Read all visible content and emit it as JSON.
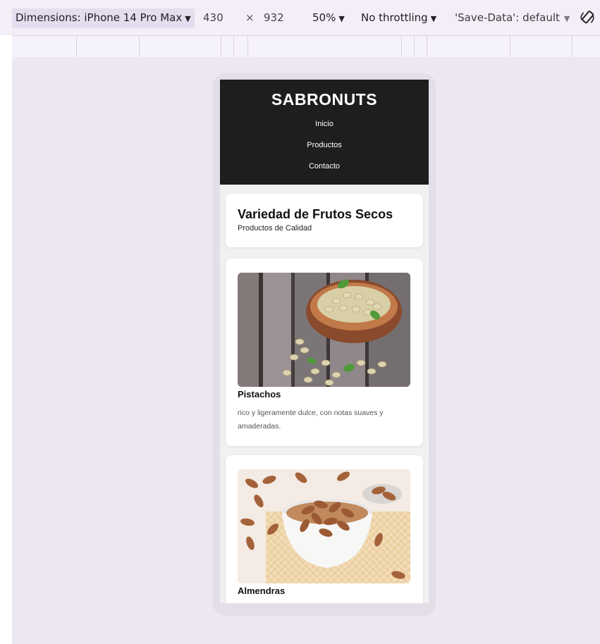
{
  "devtools": {
    "dimensions_label": "Dimensions: iPhone 14 Pro Max",
    "width": "430",
    "times": "×",
    "height": "932",
    "zoom": "50%",
    "throttling": "No throttling",
    "save_data": "'Save-Data': default",
    "caret": "▼",
    "icons": {
      "dropdown": "caret-down-icon",
      "rotate": "rotate-icon"
    }
  },
  "site": {
    "title": "SABRONUTS",
    "nav": [
      {
        "label": "Inicio"
      },
      {
        "label": "Productos"
      },
      {
        "label": "Contacto"
      }
    ]
  },
  "hero": {
    "title": "Variedad de Frutos Secos",
    "subtitle": "Productos de Calidad"
  },
  "products": [
    {
      "name": "Pistachos",
      "description": "rico y ligeramente dulce, con notas suaves y amaderadas.",
      "image": "pistachios-bowl-image"
    },
    {
      "name": "Almendras",
      "description": "",
      "image": "almonds-bowl-image"
    }
  ],
  "colors": {
    "header_bg": "#1e1e1e",
    "page_bg": "#f1f1f1",
    "card_bg": "#ffffff",
    "devtools_bg": "#f3eef8",
    "viewport_bg": "#ede7f2"
  }
}
